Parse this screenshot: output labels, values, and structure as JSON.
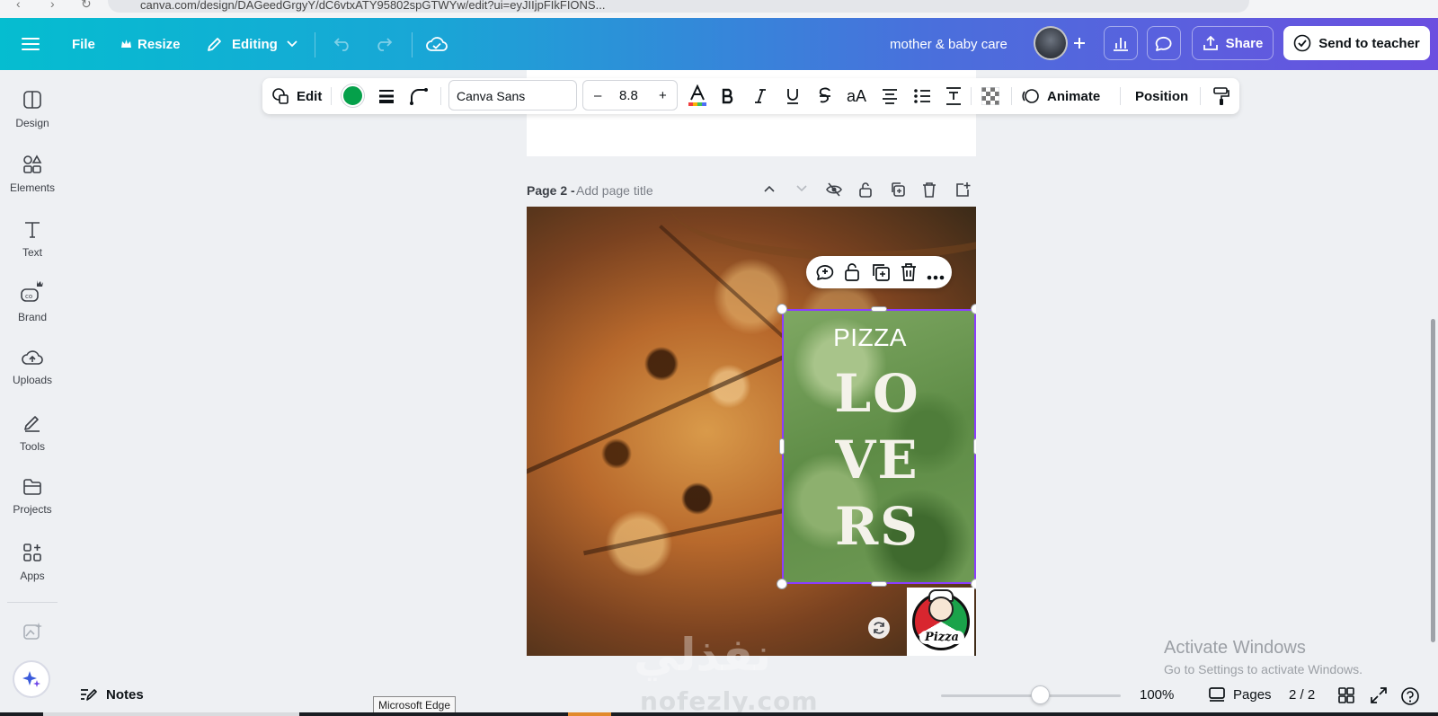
{
  "browser": {
    "url": "canva.com/design/DAGeedGrgyY/dC6vtxATY95802spGTWYw/edit?ui=eyJIIjpFIkFIONS..."
  },
  "header": {
    "menu_icon": "hamburger-icon",
    "file_label": "File",
    "resize_label": "Resize",
    "editing_label": "Editing",
    "doc_title": "mother & baby care",
    "share_label": "Share",
    "send_label": "Send to teacher"
  },
  "sidebar": {
    "items": [
      {
        "label": "Design",
        "icon": "design-icon"
      },
      {
        "label": "Elements",
        "icon": "elements-icon"
      },
      {
        "label": "Text",
        "icon": "text-icon"
      },
      {
        "label": "Brand",
        "icon": "brand-icon"
      },
      {
        "label": "Uploads",
        "icon": "uploads-icon"
      },
      {
        "label": "Tools",
        "icon": "tools-icon"
      },
      {
        "label": "Projects",
        "icon": "projects-icon"
      },
      {
        "label": "Apps",
        "icon": "apps-icon"
      }
    ]
  },
  "toolbar": {
    "edit_label": "Edit",
    "text_color": "#05a04a",
    "font_name": "Canva Sans",
    "font_size": "8.8",
    "minus": "–",
    "plus": "+",
    "case_label": "aA",
    "animate_label": "Animate",
    "position_label": "Position"
  },
  "page": {
    "label": "Page 2 -",
    "title_placeholder": "Add page title"
  },
  "design": {
    "small_text": "PIZZA",
    "big_lines": [
      "LO",
      "VE",
      "RS"
    ],
    "logo_word": "Pizza"
  },
  "watermark": {
    "arabic": "نفذلي",
    "site": "nofezly.com"
  },
  "windows": {
    "activate_title": "Activate Windows",
    "activate_sub": "Go to Settings to activate Windows."
  },
  "footer": {
    "notes_label": "Notes",
    "zoom_value": "100%",
    "zoom_level": 0.55,
    "pages_label": "Pages",
    "page_count": "2 / 2",
    "tooltip": "Microsoft Edge"
  },
  "colors": {
    "header_start": "#05bdd0",
    "header_end": "#6b4fe0",
    "selection": "#8b3dff"
  }
}
